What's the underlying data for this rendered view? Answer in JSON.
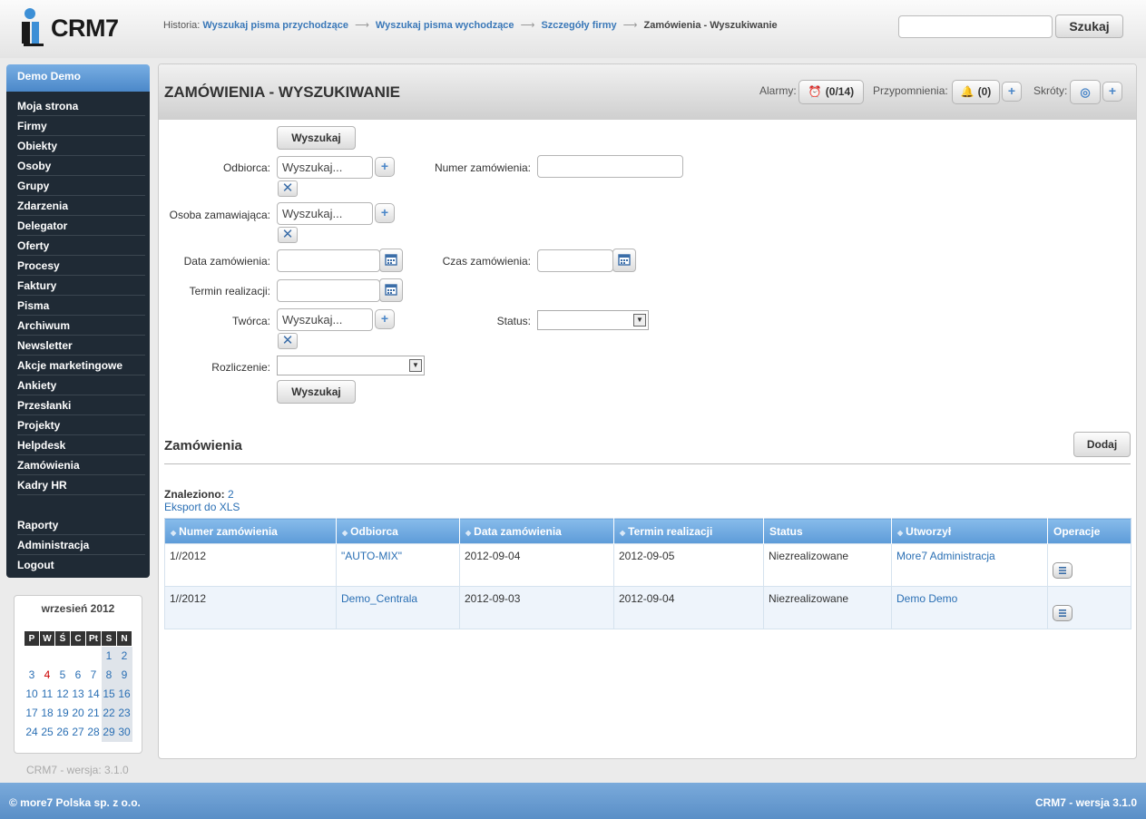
{
  "app": {
    "name": "CRM7"
  },
  "history": {
    "label": "Historia:",
    "items": [
      "Wyszukaj pisma przychodzące",
      "Wyszukaj pisma wychodzące",
      "Szczegóły firmy"
    ],
    "current": "Zamówienia - Wyszukiwanie"
  },
  "search": {
    "button": "Szukaj",
    "value": ""
  },
  "sidebar": {
    "user": "Demo Demo",
    "items": [
      {
        "label": "Moja strona"
      },
      {
        "label": "Firmy"
      },
      {
        "label": "Obiekty"
      },
      {
        "label": "Osoby"
      },
      {
        "label": "Grupy"
      },
      {
        "label": "Zdarzenia"
      },
      {
        "label": "Delegator"
      },
      {
        "label": "Oferty"
      },
      {
        "label": "Procesy"
      },
      {
        "label": "Faktury"
      },
      {
        "label": "Pisma"
      },
      {
        "label": "Archiwum"
      },
      {
        "label": "Newsletter"
      },
      {
        "label": "Akcje marketingowe"
      },
      {
        "label": "Ankiety"
      },
      {
        "label": "Przesłanki"
      },
      {
        "label": "Projekty"
      },
      {
        "label": "Helpdesk"
      },
      {
        "label": "Zamówienia"
      },
      {
        "label": "Kadry HR"
      },
      {
        "label": "Raporty"
      },
      {
        "label": "Administracja"
      },
      {
        "label": "Logout"
      }
    ]
  },
  "calendar": {
    "title": "wrzesień 2012",
    "days": [
      "P",
      "W",
      "Ś",
      "C",
      "Pt",
      "S",
      "N"
    ],
    "today": "4",
    "weeks": [
      [
        "",
        "",
        "",
        "",
        "",
        "1",
        "2"
      ],
      [
        "3",
        "4",
        "5",
        "6",
        "7",
        "8",
        "9"
      ],
      [
        "10",
        "11",
        "12",
        "13",
        "14",
        "15",
        "16"
      ],
      [
        "17",
        "18",
        "19",
        "20",
        "21",
        "22",
        "23"
      ],
      [
        "24",
        "25",
        "26",
        "27",
        "28",
        "29",
        "30"
      ]
    ]
  },
  "version_sidebar": "CRM7 - wersja: 3.1.0",
  "header": {
    "title": "ZAMÓWIENIA - WYSZUKIWANIE",
    "alarmy_label": "Alarmy:",
    "alarmy_count": "(0/14)",
    "przypomnienia_label": "Przypomnienia:",
    "przypomnienia_count": "(0)",
    "skroty_label": "Skróty:"
  },
  "form": {
    "search_button": "Wyszukaj",
    "odbiorca_label": "Odbiorca:",
    "odbiorca_value": "Wyszukaj...",
    "numer_label": "Numer zamówienia:",
    "osoba_label": "Osoba zamawiająca:",
    "osoba_value": "Wyszukaj...",
    "data_label": "Data zamówienia:",
    "czas_label": "Czas zamówienia:",
    "termin_label": "Termin realizacji:",
    "tworca_label": "Twórca:",
    "tworca_value": "Wyszukaj...",
    "status_label": "Status:",
    "rozliczenie_label": "Rozliczenie:"
  },
  "results": {
    "section_title": "Zamówienia",
    "add_button": "Dodaj",
    "found_label": "Znaleziono:",
    "found_count": "2",
    "export": "Eksport do XLS",
    "columns": [
      "Numer zamówienia",
      "Odbiorca",
      "Data zamówienia",
      "Termin realizacji",
      "Status",
      "Utworzył",
      "Operacje"
    ],
    "rows": [
      {
        "numer": "1//2012",
        "odbiorca": "\"AUTO-MIX\"",
        "data": "2012-09-04",
        "termin": "2012-09-05",
        "status": "Niezrealizowane",
        "utworzyl": "More7 Administracja"
      },
      {
        "numer": "1//2012",
        "odbiorca": "Demo_Centrala",
        "data": "2012-09-03",
        "termin": "2012-09-04",
        "status": "Niezrealizowane",
        "utworzyl": "Demo Demo"
      }
    ]
  },
  "footer": {
    "left": "© more7 Polska sp. z o.o.",
    "right": "CRM7 - wersja 3.1.0"
  }
}
